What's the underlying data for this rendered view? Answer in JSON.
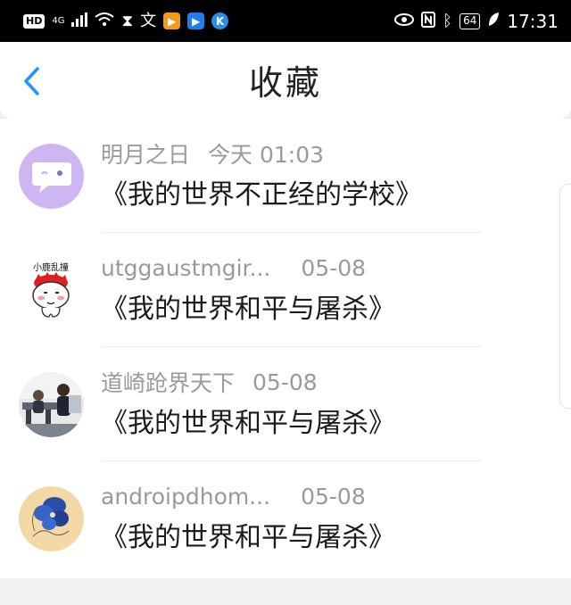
{
  "status_bar": {
    "hd": "HD",
    "network": "4G",
    "battery": "64",
    "time": "17:31",
    "app_icons": [
      {
        "name": "sogou-icon",
        "color": "#f39a18",
        "glyph": "▶"
      },
      {
        "name": "arrow-app-icon",
        "color": "#1f7fe8",
        "glyph": "▶"
      },
      {
        "name": "k-app-icon",
        "color": "#2a8de6",
        "glyph": "K"
      }
    ]
  },
  "header": {
    "title": "收藏",
    "back_icon": "chevron-left-icon",
    "accent_color": "#2196f3"
  },
  "favorites": [
    {
      "user": "明月之日",
      "time": "今天 01:03",
      "title": "《我的世界不正经的学校》",
      "avatar": "chat-bubble-avatar"
    },
    {
      "user": "utggaustmgir...",
      "time": "05-08",
      "title": "《我的世界和平与屠杀》",
      "avatar": "cartoon-avatar",
      "avatar_text": "小鹿乱撞"
    },
    {
      "user": "道崎跄界天下",
      "time": "05-08",
      "title": "《我的世界和平与屠杀》",
      "avatar": "photo-avatar"
    },
    {
      "user": "androipdhom...",
      "time": "05-08",
      "title": "《我的世界和平与屠杀》",
      "avatar": "flower-avatar"
    }
  ]
}
